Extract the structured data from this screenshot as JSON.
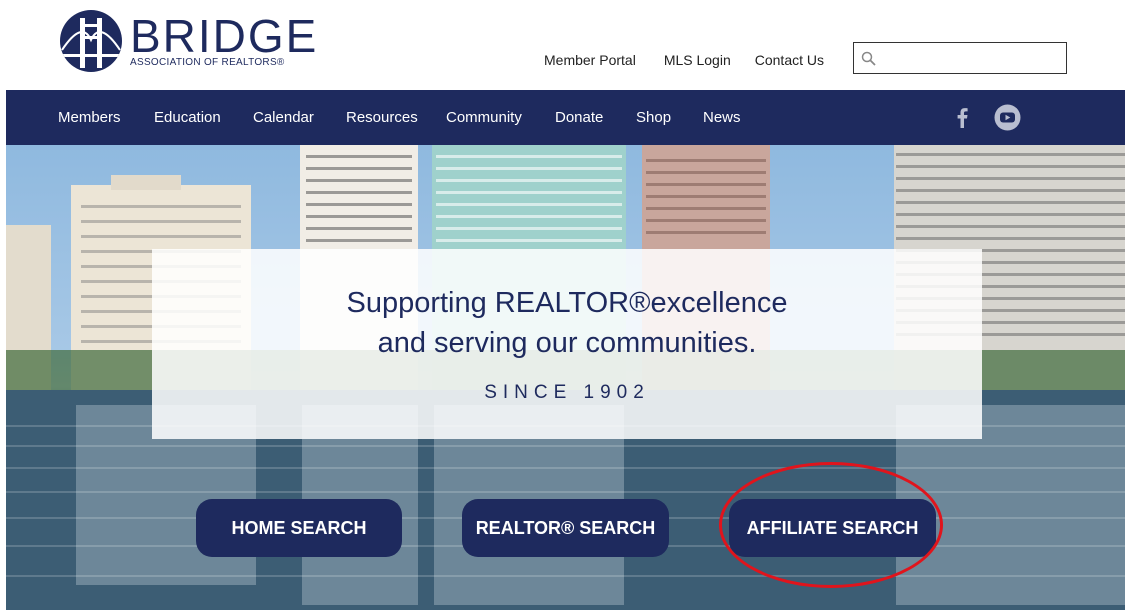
{
  "brand": {
    "name": "BRIDGE",
    "subtitle": "ASSOCIATION OF REALTORS®"
  },
  "top_links": [
    "Member Portal",
    "MLS Login",
    "Contact Us"
  ],
  "search": {
    "placeholder": ""
  },
  "nav": {
    "items": [
      "Members",
      "Education",
      "Calendar",
      "Resources",
      "Community",
      "Donate",
      "Shop",
      "News"
    ],
    "social": [
      "facebook-icon",
      "youtube-icon"
    ]
  },
  "hero": {
    "line1": "Supporting REALTOR®excellence",
    "line2": "and serving our communities.",
    "since": "SINCE 1902"
  },
  "cta": {
    "home": "HOME SEARCH",
    "realtor": "REALTOR® SEARCH",
    "affiliate": "AFFILIATE SEARCH"
  },
  "colors": {
    "brand_navy": "#1e2a5e",
    "annotation_red": "#e0141c"
  }
}
